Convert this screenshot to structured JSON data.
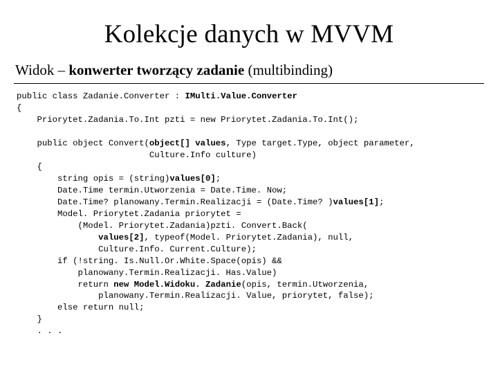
{
  "title": "Kolekcje danych w MVVM",
  "subtitle_prefix": "Widok – ",
  "subtitle_bold": "konwerter tworzący zadanie",
  "subtitle_suffix": " (multibinding)",
  "code": {
    "l01a": "public class Zadanie.Converter : ",
    "l01b": "IMulti.Value.Converter",
    "l02": "{",
    "l03": "    Priorytet.Zadania.To.Int pzti = new Priorytet.Zadania.To.Int();",
    "l04": "",
    "l05a": "    public object Convert(",
    "l05b": "object[] values",
    "l05c": ", Type target.Type, object parameter,",
    "l06": "                          Culture.Info culture)",
    "l07": "    {",
    "l08a": "        string opis = (string)",
    "l08b": "values[0]",
    "l08c": ";",
    "l09": "        Date.Time termin.Utworzenia = Date.Time. Now;",
    "l10a": "        Date.Time? planowany.Termin.Realizacji = (Date.Time? )",
    "l10b": "values[1]",
    "l10c": ";",
    "l11": "        Model. Priorytet.Zadania priorytet =",
    "l12": "            (Model. Priorytet.Zadania)pzti. Convert.Back(",
    "l13a": "                ",
    "l13b": "values[2]",
    "l13c": ", typeof(Model. Priorytet.Zadania), null,",
    "l14": "                Culture.Info. Current.Culture);",
    "l15": "        if (!string. Is.Null.Or.White.Space(opis) &&",
    "l16": "            planowany.Termin.Realizacji. Has.Value)",
    "l17a": "            return ",
    "l17b": "new Model.Widoku. Zadanie",
    "l17c": "(opis, termin.Utworzenia,",
    "l18": "                planowany.Termin.Realizacji. Value, priorytet, false);",
    "l19": "        else return null;",
    "l20": "    }",
    "l21": "    . . ."
  }
}
